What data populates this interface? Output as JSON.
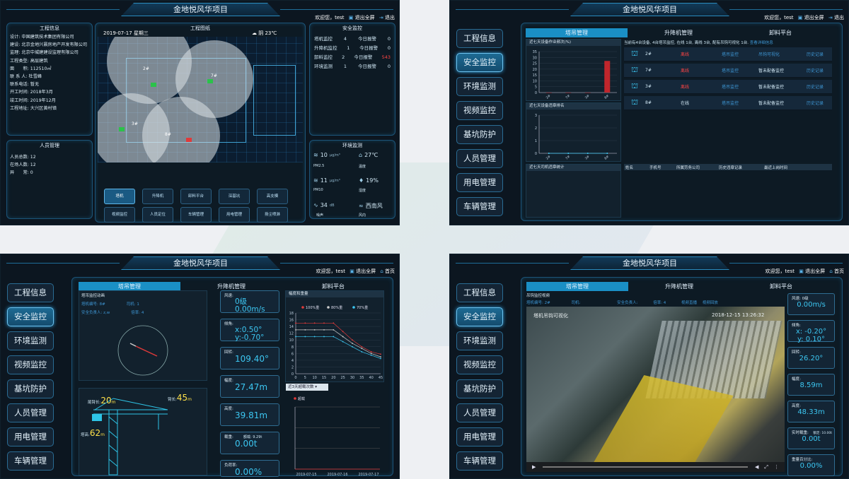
{
  "project_title": "金地悦风华项目",
  "welcome": "欢迎您，test",
  "fullscreen_exit": "退出全屏",
  "logout": "退出",
  "home": "首页",
  "nav": [
    "工程信息",
    "安全监控",
    "环境监测",
    "视频监控",
    "基坑防护",
    "人员管理",
    "用电管理",
    "车辆管理"
  ],
  "monitor_tabs": [
    "塔吊管理",
    "升降机管理",
    "卸料平台"
  ],
  "s1": {
    "eng_title": "工程信息",
    "eng_lines": [
      "设计: 中国建筑技术集团有限公司",
      "建设: 北京金地兴晨房地产开发有限公司",
      "监理: 北京中城建建设监理有限公司",
      "工程类型: 高层建筑",
      "面　　积: 112510㎡",
      "联 系 人: 杜雪峰",
      "联系电话: 暂无",
      "开工时间: 2018年3月",
      "竣工时间: 2019年12月",
      "工程地址: 大兴区黄村镇"
    ],
    "person_title": "人员管理",
    "person_lines": [
      "人员总数: 12",
      "在场人数: 12",
      "异　　常: 0"
    ],
    "map_title": "工程图纸",
    "date": "2019-07-17 星期三",
    "weather": "阴 23℃",
    "crane_labels": [
      "2#",
      "7#",
      "3#",
      "8#"
    ],
    "btn_row1": [
      "塔机",
      "升降机",
      "卸料平台",
      "深基坑",
      "高支模"
    ],
    "btn_row2": [
      "视频监控",
      "人员定位",
      "车辆管理",
      "用电管理",
      "扬尘喷淋"
    ],
    "safety_title": "安全监控",
    "safety_rows": [
      {
        "name": "塔机监控",
        "count": "4",
        "label": "今日报警",
        "alarm": "0"
      },
      {
        "name": "升降机监控",
        "count": "1",
        "label": "今日报警",
        "alarm": "0"
      },
      {
        "name": "卸料监控",
        "count": "2",
        "label": "今日报警",
        "alarm": "543"
      },
      {
        "name": "环境监测",
        "count": "1",
        "label": "今日报警",
        "alarm": "0"
      }
    ],
    "env_title": "环境监测",
    "env": {
      "pm25": "10",
      "pm25_unit": "μg/m³",
      "pm25_lbl": "PM2.5",
      "temp": "27℃",
      "temp_lbl": "温度",
      "pm10": "11",
      "pm10_unit": "μg/m³",
      "pm10_lbl": "PM10",
      "hum": "19%",
      "hum_lbl": "湿度",
      "noise": "34",
      "noise_unit": "dB",
      "noise_lbl": "噪声",
      "wind": "西南风",
      "wind_lbl": "风向"
    }
  },
  "s2": {
    "chart1_title": "近七天设备作业频次(%)",
    "chart2_title": "近七天设备违章排名",
    "table3_title": "近七天司机违章统计",
    "summary": "当前有4台设备, 4台塔吊监控, 在线 1台, 离线 3台, 配有吊钩可视化 1台.",
    "more": "查看详细信息",
    "crane_rows": [
      {
        "id": "2#",
        "status": "离线",
        "link": "塔吊监控",
        "video": "吊钩可视化",
        "history": "历史记录"
      },
      {
        "id": "7#",
        "status": "离线",
        "link": "塔吊监控",
        "video": "暂未配备监控",
        "history": "历史记录"
      },
      {
        "id": "3#",
        "status": "离线",
        "link": "塔吊监控",
        "video": "暂未配备监控",
        "history": "历史记录"
      },
      {
        "id": "8#",
        "status": "在线",
        "link": "塔吊监控",
        "video": "暂未配备监控",
        "history": "历史记录"
      }
    ],
    "table_headers": [
      "姓名",
      "手机号",
      "所属劳务公司",
      "历史违章记录",
      "最近上岗时间"
    ],
    "chart_data": [
      {
        "type": "bar",
        "title": "近七天设备作业频次(%)",
        "categories": [
          "2#",
          "7#",
          "3#",
          "8#"
        ],
        "values": [
          0,
          0,
          0,
          27
        ],
        "ylim": [
          0,
          35
        ],
        "yticks": [
          0,
          5,
          10,
          15,
          20,
          25,
          30,
          35
        ]
      },
      {
        "type": "line",
        "title": "近七天设备违章排名",
        "categories": [
          "2#",
          "7#",
          "3#",
          "8#"
        ],
        "values": [
          0,
          0,
          0,
          0
        ],
        "ylim": [
          0,
          3
        ],
        "yticks": [
          0,
          1,
          2,
          3
        ]
      }
    ]
  },
  "s3": {
    "panel_title": "塔吊监控动画",
    "tower_no_lbl": "塔机编号: 8#",
    "driver_lbl": "司机: 1",
    "safety_lbl": "安全负责人: z,w",
    "rate_lbl": "倍率: 4",
    "dims": {
      "rear_lbl": "尾臂长:",
      "rear": "20",
      "rear_unit": "m",
      "arm_lbl": "臂长:",
      "arm": "45",
      "arm_unit": "m",
      "h_lbl": "塔高:",
      "h": "62",
      "h_unit": "m"
    },
    "cards": [
      {
        "label": "风速:",
        "v1": "0级",
        "v2": "0.00m/s"
      },
      {
        "label": "倾角:",
        "v1": "x:0.50°",
        "v2": "y:-0.70°"
      },
      {
        "label": "回转:",
        "v1": "109.40°"
      },
      {
        "label": "幅度:",
        "v1": "27.47m"
      },
      {
        "label": "高度:",
        "v1": "39.81m"
      },
      {
        "label": "载重:",
        "sub": "额载: 9.29t",
        "v1": "0.00t"
      },
      {
        "label": "负荷率:",
        "v1": "0.00%"
      }
    ],
    "chart_title": "幅度和重量",
    "select_label": "近3天超载次数",
    "chart_data": [
      {
        "type": "line",
        "title": "幅度和重量",
        "x": [
          0,
          5,
          10,
          15,
          20,
          25,
          30,
          35,
          40,
          45
        ],
        "series": [
          {
            "name": "100%重",
            "values": [
              15,
              15,
              15,
              15,
              15,
              12.5,
              10,
              8,
              6.5,
              5.8
            ]
          },
          {
            "name": "80%重",
            "values": [
              13,
              13,
              13,
              13,
              13,
              11,
              9,
              7.5,
              6,
              5
            ]
          },
          {
            "name": "70%重",
            "values": [
              11,
              11,
              11,
              11,
              11,
              9.5,
              8,
              6.5,
              5.5,
              4.5
            ]
          }
        ],
        "ylim": [
          0,
          18
        ],
        "yticks": [
          0,
          2,
          4,
          6,
          8,
          10,
          12,
          14,
          16,
          18
        ]
      },
      {
        "type": "line",
        "title": "近3天超载次数",
        "series": [
          {
            "name": "超载",
            "values": [
              0,
              0,
              0
            ]
          }
        ],
        "categories": [
          "2019-07-15",
          "2019-07-16",
          "2019-07-17"
        ]
      }
    ]
  },
  "s4": {
    "panel_title": "吊钩监控视频",
    "tower_no_lbl": "塔机编号: 2#",
    "driver_lbl": "司机:",
    "safety_lbl": "安全负责人:",
    "rate_lbl": "倍率: 4",
    "links": [
      "视频直播",
      "视频回放"
    ],
    "video_time": "2018-12-15 13:26:32",
    "video_label": "塔机吊钩可视化",
    "cards": [
      {
        "label": "风速: 0级",
        "v1": "0.00m/s"
      },
      {
        "label": "倾角:",
        "v1": "x: -0.20°",
        "v2": "y: 0.10°"
      },
      {
        "label": "回转:",
        "v1": "26.20°"
      },
      {
        "label": "幅度:",
        "v1": "8.59m"
      },
      {
        "label": "高度:",
        "v1": "48.33m"
      },
      {
        "label": "实时载重:",
        "sub": "额定: 10.00t",
        "v1": "0.00t"
      },
      {
        "label": "重量百分比:",
        "v1": "0.00%"
      }
    ]
  }
}
